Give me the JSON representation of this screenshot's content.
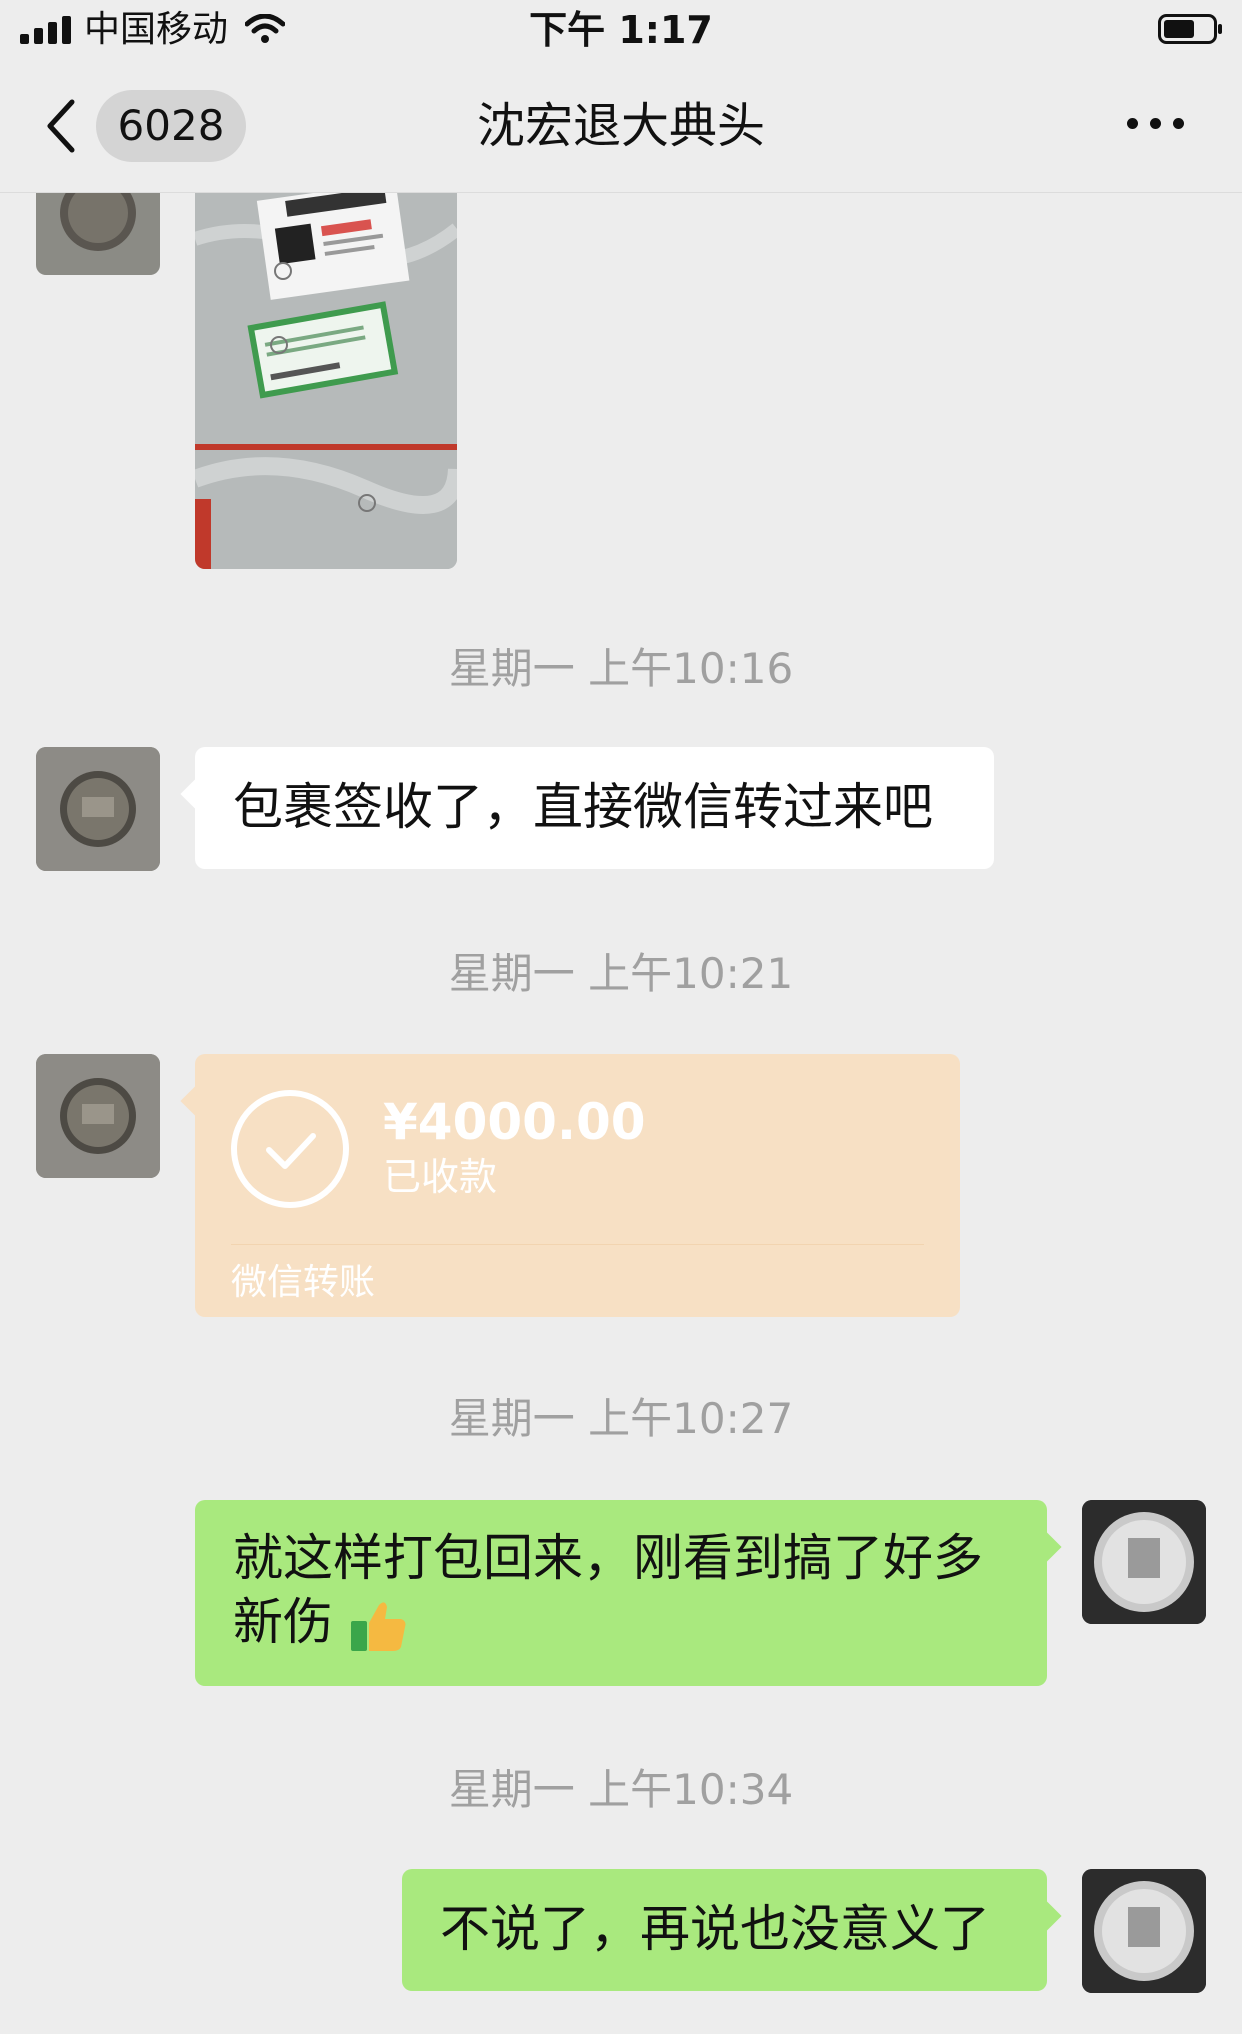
{
  "status_bar": {
    "carrier": "中国移动",
    "time": "下午 1:17"
  },
  "nav": {
    "unread_count": "6028",
    "title": "沈宏退大典头"
  },
  "messages": [
    {
      "type": "timestamp",
      "text": "星期一 上午10:16"
    },
    {
      "type": "text",
      "from": "contact",
      "text": "包裹签收了，直接微信转过来吧"
    },
    {
      "type": "timestamp",
      "text": "星期一 上午10:21"
    },
    {
      "type": "transfer",
      "from": "contact",
      "amount": "¥4000.00",
      "status": "已收款",
      "label": "微信转账"
    },
    {
      "type": "timestamp",
      "text": "星期一 上午10:27"
    },
    {
      "type": "text",
      "from": "me",
      "text_line1": "就这样打包回来，刚看到搞了好多",
      "text_line2": "新伤"
    },
    {
      "type": "timestamp",
      "text": "星期一 上午10:34"
    },
    {
      "type": "text",
      "from": "me",
      "text": "不说了，再说也没意义了"
    }
  ],
  "colors": {
    "background": "#ededed",
    "bubble_incoming": "#ffffff",
    "bubble_outgoing": "#a9e97e",
    "transfer_card": "#f7e0c4",
    "timestamp_text": "#a0a0a0"
  },
  "icons": {
    "back": "chevron-left-icon",
    "more": "more-dots-icon",
    "transfer_received": "check-circle-icon",
    "emoji": "thumbs-up-icon"
  }
}
